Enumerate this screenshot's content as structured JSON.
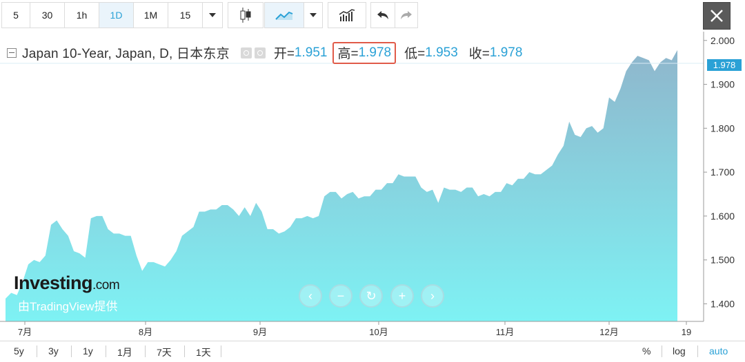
{
  "toolbar": {
    "intervals": [
      "5",
      "30",
      "1h",
      "1D",
      "1M",
      "15"
    ],
    "active_interval": "1D",
    "icons": [
      "chevron-down-icon",
      "candlestick-icon",
      "area-chart-icon",
      "chevron-down-icon",
      "indicators-icon",
      "undo-icon",
      "redo-icon",
      "close-icon"
    ]
  },
  "legend": {
    "title": "Japan 10-Year, Japan, D, 日本东京",
    "open_label": "开=",
    "open": "1.951",
    "high_label": "高=",
    "high": "1.978",
    "low_label": "低=",
    "low": "1.953",
    "close_label": "收=",
    "close": "1.978"
  },
  "price_tag": "1.978",
  "logo": {
    "brand": "Investing",
    "suffix": ".com",
    "sub": "由TradingView提供"
  },
  "bottom": {
    "ranges": [
      "5y",
      "3y",
      "1y",
      "1月",
      "7天",
      "1天"
    ],
    "right": [
      "%",
      "log",
      "auto"
    ]
  },
  "colors": {
    "accent": "#2aa1d6",
    "highlight_box": "#e05a48",
    "area_top": "#8fb6cc",
    "area_bottom": "#7ef2f4"
  },
  "chart_data": {
    "type": "area",
    "x_ticks": [
      "7月",
      "8月",
      "9月",
      "10月",
      "11月",
      "12月",
      "19"
    ],
    "y_ticks": [
      "1.400",
      "1.500",
      "1.600",
      "1.700",
      "1.800",
      "1.900",
      "2.000"
    ],
    "ylim": [
      1.36,
      2.02
    ],
    "series": [
      {
        "values": [
          1.412,
          1.425,
          1.42,
          1.45,
          1.49,
          1.5,
          1.495,
          1.51,
          1.58,
          1.59,
          1.57,
          1.555,
          1.52,
          1.515,
          1.505,
          1.595,
          1.6,
          1.6,
          1.57,
          1.56,
          1.56,
          1.555,
          1.555,
          1.51,
          1.475,
          1.495,
          1.495,
          1.49,
          1.485,
          1.5,
          1.52,
          1.555,
          1.565,
          1.575,
          1.61,
          1.61,
          1.615,
          1.615,
          1.625,
          1.625,
          1.615,
          1.6,
          1.62,
          1.6,
          1.63,
          1.61,
          1.57,
          1.57,
          1.56,
          1.565,
          1.575,
          1.595,
          1.595,
          1.6,
          1.595,
          1.6,
          1.645,
          1.655,
          1.655,
          1.64,
          1.65,
          1.655,
          1.64,
          1.645,
          1.645,
          1.66,
          1.66,
          1.675,
          1.675,
          1.695,
          1.69,
          1.69,
          1.69,
          1.665,
          1.655,
          1.66,
          1.63,
          1.665,
          1.66,
          1.66,
          1.655,
          1.665,
          1.665,
          1.645,
          1.65,
          1.645,
          1.655,
          1.655,
          1.675,
          1.67,
          1.685,
          1.685,
          1.7,
          1.695,
          1.695,
          1.705,
          1.715,
          1.74,
          1.76,
          1.815,
          1.785,
          1.78,
          1.8,
          1.805,
          1.79,
          1.8,
          1.87,
          1.86,
          1.89,
          1.93,
          1.95,
          1.965,
          1.96,
          1.955,
          1.93,
          1.95,
          1.96,
          1.955,
          1.978
        ]
      }
    ]
  }
}
